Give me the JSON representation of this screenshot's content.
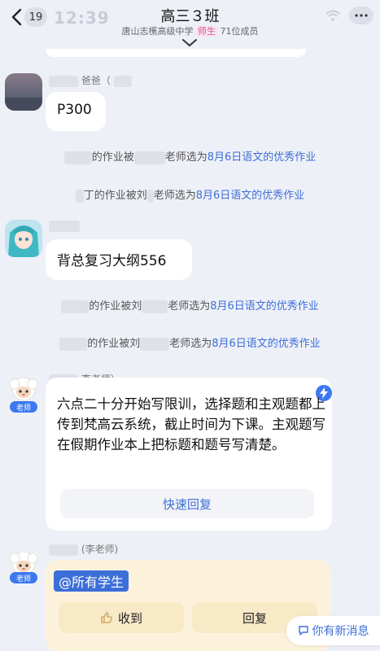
{
  "header": {
    "back_icon": "chevron-left-icon",
    "unread_count": "19",
    "status_time": "12:39",
    "title": "高三３班",
    "school": "唐山志櫵高级中学",
    "school_tag": "师生",
    "member_count": "71位成员"
  },
  "messages": [
    {
      "sender_suffix": "爸爸（",
      "text": "P300"
    },
    {
      "sender_suffix": "",
      "text": "背总复习大纲556"
    }
  ],
  "system_messages": [
    {
      "prefix": "的作业被",
      "middle": "老师选为",
      "highlight": "8月6日语文的优秀作业"
    },
    {
      "prefix": "丁的作业被刘",
      "middle": "老师选为",
      "highlight": "8月6日语文的优秀作业"
    },
    {
      "prefix": "的作业被刘",
      "middle": "老师选为",
      "highlight": "8月6日语文的优秀作业"
    },
    {
      "prefix": "的作业被刘",
      "middle": "老师选为",
      "highlight": "8月6日语文的优秀作业"
    }
  ],
  "notice": {
    "sender": "李老师）",
    "teacher_tag": "老师",
    "text": "六点二十分开始写限训，选择题和主观题都上传到梵高云系统，截止时间为下课。主观题写在假期作业本上把标题和题号写清楚。",
    "quick_reply_label": "快速回复"
  },
  "mention_message": {
    "sender": "(李老师)",
    "teacher_tag": "老师",
    "mention": "@所有学生",
    "received_label": "收到",
    "reply_label": "回复"
  },
  "new_message_label": "你有新消息",
  "colors": {
    "accent": "#3c6ed8",
    "background": "#eef0f7",
    "notice_yellow": "#fcf2dc"
  }
}
